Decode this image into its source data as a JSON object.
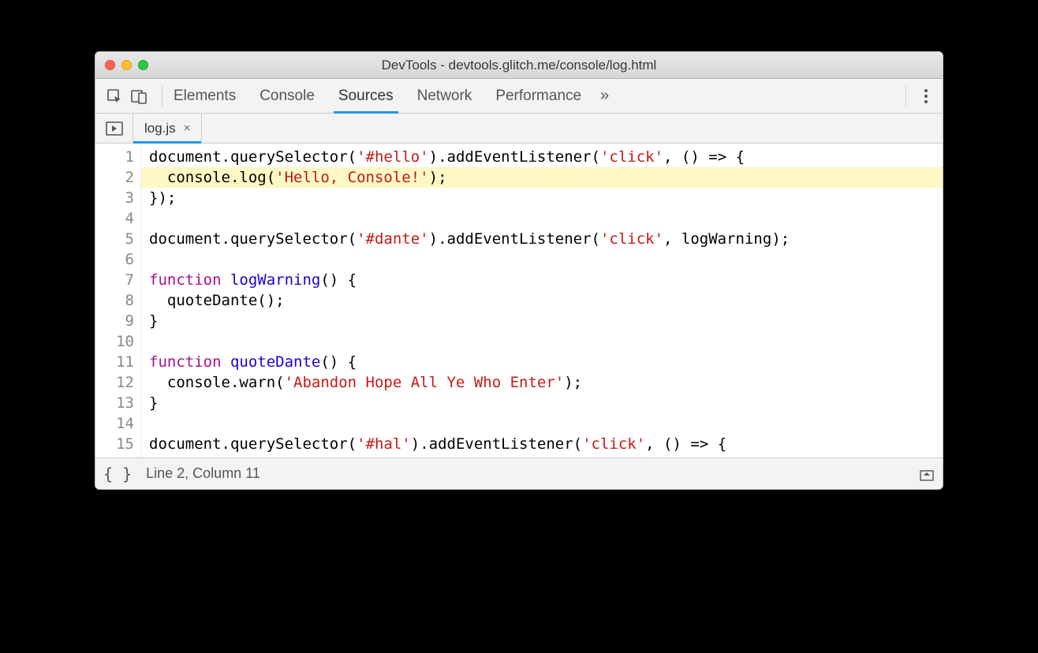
{
  "window": {
    "title": "DevTools - devtools.glitch.me/console/log.html"
  },
  "toolbar": {
    "tabs": [
      "Elements",
      "Console",
      "Sources",
      "Network",
      "Performance"
    ],
    "active_tab_index": 2,
    "more_glyph": "»"
  },
  "file_tab": {
    "name": "log.js",
    "close_glyph": "×"
  },
  "code": {
    "highlighted_line": 2,
    "lines": [
      {
        "n": 1,
        "tokens": [
          {
            "t": "document.querySelector("
          },
          {
            "t": "'#hello'",
            "c": "tok-str"
          },
          {
            "t": ").addEventListener("
          },
          {
            "t": "'click'",
            "c": "tok-str"
          },
          {
            "t": ", () "
          },
          {
            "t": "=>",
            "c": "tok-punc"
          },
          {
            "t": " {"
          }
        ]
      },
      {
        "n": 2,
        "hl": true,
        "tokens": [
          {
            "t": "  console.log("
          },
          {
            "t": "'Hello, Console!'",
            "c": "tok-str"
          },
          {
            "t": ");"
          }
        ]
      },
      {
        "n": 3,
        "tokens": [
          {
            "t": "});"
          }
        ]
      },
      {
        "n": 4,
        "tokens": [
          {
            "t": ""
          }
        ]
      },
      {
        "n": 5,
        "tokens": [
          {
            "t": "document.querySelector("
          },
          {
            "t": "'#dante'",
            "c": "tok-str"
          },
          {
            "t": ").addEventListener("
          },
          {
            "t": "'click'",
            "c": "tok-str"
          },
          {
            "t": ", logWarning);"
          }
        ]
      },
      {
        "n": 6,
        "tokens": [
          {
            "t": ""
          }
        ]
      },
      {
        "n": 7,
        "tokens": [
          {
            "t": "function",
            "c": "tok-kw"
          },
          {
            "t": " "
          },
          {
            "t": "logWarning",
            "c": "tok-def"
          },
          {
            "t": "() {"
          }
        ]
      },
      {
        "n": 8,
        "tokens": [
          {
            "t": "  quoteDante();"
          }
        ]
      },
      {
        "n": 9,
        "tokens": [
          {
            "t": "}"
          }
        ]
      },
      {
        "n": 10,
        "tokens": [
          {
            "t": ""
          }
        ]
      },
      {
        "n": 11,
        "tokens": [
          {
            "t": "function",
            "c": "tok-kw"
          },
          {
            "t": " "
          },
          {
            "t": "quoteDante",
            "c": "tok-def"
          },
          {
            "t": "() {"
          }
        ]
      },
      {
        "n": 12,
        "tokens": [
          {
            "t": "  console.warn("
          },
          {
            "t": "'Abandon Hope All Ye Who Enter'",
            "c": "tok-str"
          },
          {
            "t": ");"
          }
        ]
      },
      {
        "n": 13,
        "tokens": [
          {
            "t": "}"
          }
        ]
      },
      {
        "n": 14,
        "tokens": [
          {
            "t": ""
          }
        ]
      },
      {
        "n": 15,
        "tokens": [
          {
            "t": "document.querySelector("
          },
          {
            "t": "'#hal'",
            "c": "tok-str"
          },
          {
            "t": ").addEventListener("
          },
          {
            "t": "'click'",
            "c": "tok-str"
          },
          {
            "t": ", () "
          },
          {
            "t": "=>",
            "c": "tok-punc"
          },
          {
            "t": " {"
          }
        ]
      }
    ]
  },
  "status": {
    "format_label": "{ }",
    "cursor_label": "Line 2, Column 11"
  }
}
